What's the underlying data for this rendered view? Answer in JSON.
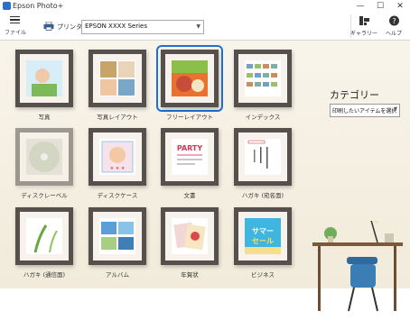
{
  "window": {
    "title": "Epson Photo+",
    "minimize": "—",
    "maximize": "☐",
    "close": "✕"
  },
  "toolbar": {
    "file_label": "ファイル",
    "printer_label": "プリンター",
    "printer_value": "EPSON XXXX Series",
    "gallery_label": "ギャラリー",
    "help_label": "ヘルプ"
  },
  "category": {
    "title": "カテゴリー",
    "selected": "印刷したいアイテムを選択"
  },
  "items": [
    {
      "label": "写真"
    },
    {
      "label": "写真レイアウト"
    },
    {
      "label": "フリーレイアウト"
    },
    {
      "label": "インデックス"
    },
    {
      "label": "ディスクレーベル"
    },
    {
      "label": "ディスクケース"
    },
    {
      "label": "文書"
    },
    {
      "label": "ハガキ (宛名面)"
    },
    {
      "label": "ハガキ (通信面)"
    },
    {
      "label": "アルバム"
    },
    {
      "label": "年賀状"
    },
    {
      "label": "ビジネス"
    }
  ],
  "thumb_text": {
    "party": "PARTY",
    "sale1": "サマー",
    "sale2": "セール"
  },
  "colors": {
    "frame": "#55504b",
    "selection": "#1f6fd6",
    "background": "#f5efe2"
  }
}
